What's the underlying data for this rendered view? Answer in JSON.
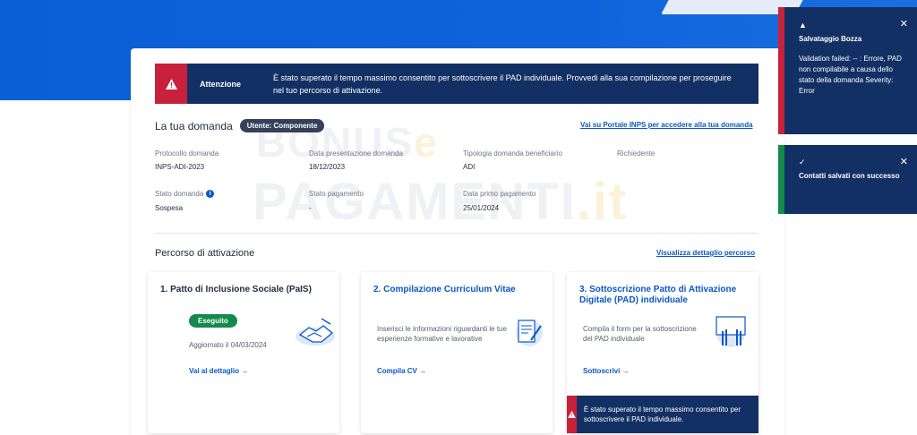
{
  "alert": {
    "title": "Attenzione",
    "message": "È stato superato il tempo massimo consentito per sottoscrivere il PAD individuale. Provvedi alla sua compilazione per proseguire nel tuo percorso di attivazione."
  },
  "domanda": {
    "title": "La tua domanda",
    "badge": "Utente: Componente",
    "portal_link": "Vai su Portale INPS per accedere alla tua domanda",
    "fields": [
      {
        "label": "Protocollo domanda",
        "value": "INPS-ADI-2023"
      },
      {
        "label": "Data presentazione domanda",
        "value": "18/12/2023"
      },
      {
        "label": "Tipologia domanda beneficiario",
        "value": "ADI"
      },
      {
        "label": "Richiedente",
        "value": ""
      },
      {
        "label": "Stato domanda",
        "value": "Sospesa"
      },
      {
        "label": "Stato pagamento",
        "value": "-"
      },
      {
        "label": "Data primo pagamento",
        "value": "25/01/2024"
      }
    ]
  },
  "percorso": {
    "title": "Percorso di attivazione",
    "detail_link": "Visualizza dettaglio percorso",
    "steps": [
      {
        "title": "1. Patto di Inclusione Sociale (PaIS)",
        "status": "Eseguito",
        "updated": "Aggiornato il 04/03/2024",
        "action": "Vai al dettaglio →"
      },
      {
        "title": "2. Compilazione Curriculum Vitae",
        "description": "Inserisci le informazioni riguardanti le tue esperienze formative e lavorative",
        "action": "Compila CV →"
      },
      {
        "title": "3. Sottoscrizione Patto di Attivazione Digitale (PAD) individuale",
        "description": "Compila il form per la sottoscrizione del PAD individuale",
        "action": "Sottoscrivi →",
        "warning": "È stato superato il tempo massimo consentito per sottoscrivere il PAD individuale."
      }
    ]
  },
  "watermark": {
    "line1": "BONUS",
    "line1b": "e",
    "line2": "PAGAMENTI",
    "line2b": ".it"
  },
  "toasts": [
    {
      "title": "Salvataggio Bozza",
      "icon": "▲",
      "body": "Validation failed: -- : Errore, PAD non compilabile a causa dello stato della domanda Severity: Error",
      "close": "✕",
      "color": "#c7213c"
    },
    {
      "title": "Contatti salvati con successo",
      "icon": "✓",
      "close": "✕",
      "color": "#138a4c"
    }
  ]
}
